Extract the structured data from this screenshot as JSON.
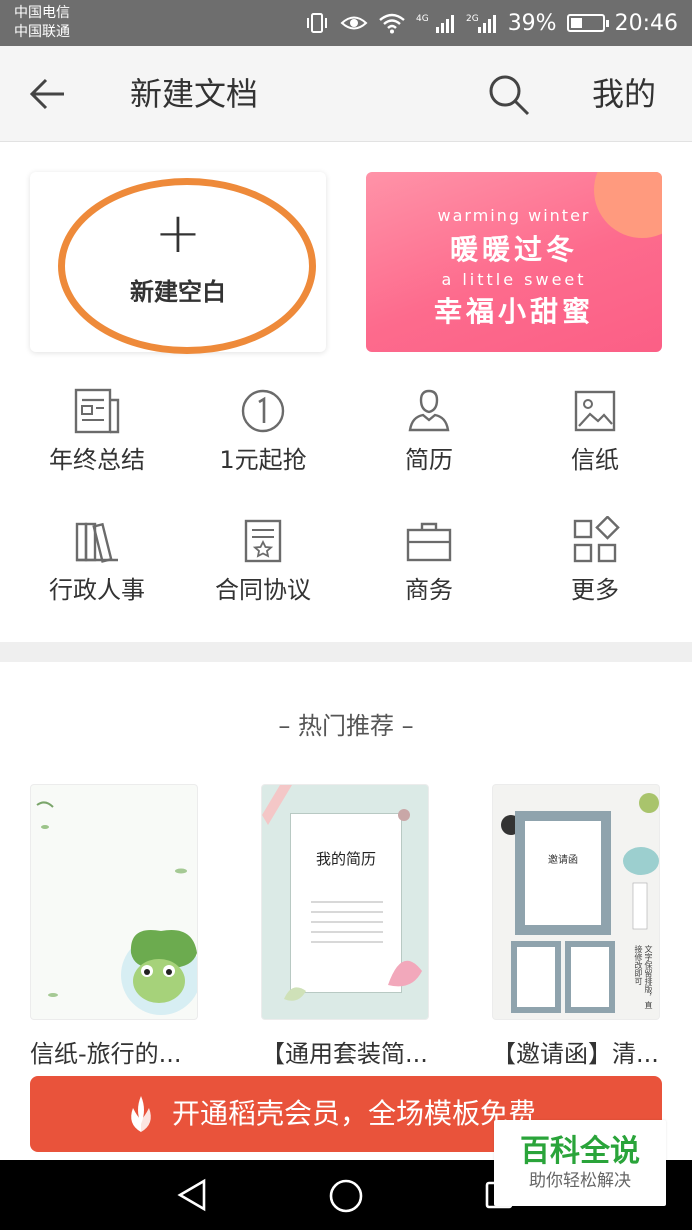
{
  "status_bar": {
    "carrier_1": "中国电信",
    "carrier_2": "中国联通",
    "network_1": "4G",
    "network_2": "2G",
    "battery": "39%",
    "battery_level": 0.39,
    "time": "20:46"
  },
  "header": {
    "title": "新建文档",
    "mine_label": "我的"
  },
  "blank_card": {
    "label": "新建空白",
    "highlight_color": "#ee8a3a"
  },
  "banner": {
    "line1": "warming winter",
    "line2": "暖暖过冬",
    "line3": "a little sweet",
    "line4": "幸福小甜蜜"
  },
  "categories": [
    {
      "label": "年终总结",
      "icon": "newspaper-icon"
    },
    {
      "label": "1元起抢",
      "icon": "one-coin-icon"
    },
    {
      "label": "简历",
      "icon": "person-icon"
    },
    {
      "label": "信纸",
      "icon": "image-icon"
    },
    {
      "label": "行政人事",
      "icon": "books-icon"
    },
    {
      "label": "合同协议",
      "icon": "contract-icon"
    },
    {
      "label": "商务",
      "icon": "briefcase-icon"
    },
    {
      "label": "更多",
      "icon": "more-grid-icon"
    }
  ],
  "hot": {
    "title": "– 热门推荐 –",
    "items": [
      {
        "label": "信纸-旅行的..."
      },
      {
        "label": "【通用套装简...",
        "thumb_text": "我的简历"
      },
      {
        "label": "【邀请函】清...",
        "thumb_text": "邀请函",
        "side_text": "文字保留排版，直接修改即可"
      }
    ]
  },
  "promo": {
    "label": "开通稻壳会员，全场模板免费",
    "color": "#e9533b"
  },
  "watermark": {
    "main": "百科全说",
    "sub": "助你轻松解决"
  },
  "colors": {
    "header_bg": "#f5f5f5",
    "status_bg": "#6e6e6e",
    "icon_gray": "#6b6b6b"
  }
}
